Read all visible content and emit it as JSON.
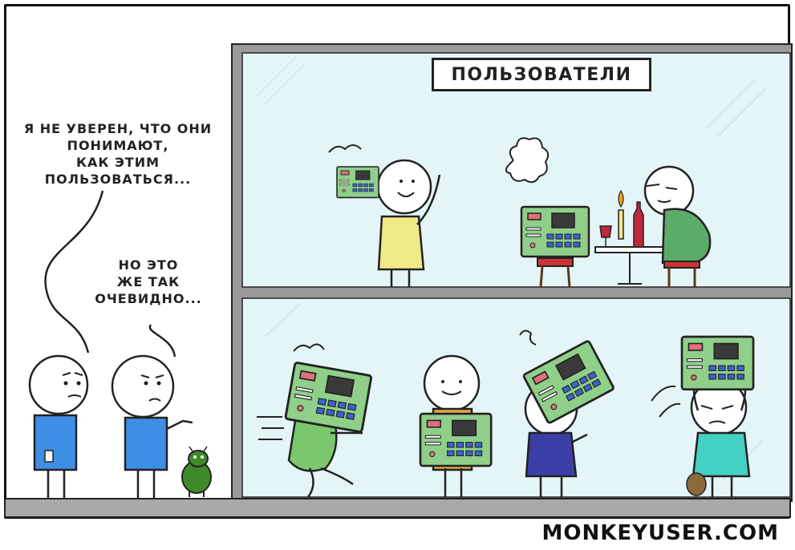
{
  "speech": {
    "left_lines": [
      "Я НЕ УВЕРЕН, ЧТО ОНИ",
      "ПОНИМАЮТ,",
      "КАК ЭТИМ",
      "ПОЛЬЗОВАТЬСЯ..."
    ],
    "right_lines": [
      "НО ЭТО",
      "ЖЕ ТАК",
      "ОЧЕВИДНО..."
    ]
  },
  "room_sign": "ПОЛЬЗОВАТЕЛИ",
  "credit": "MONKEYUSER.COM",
  "colors": {
    "glass": "#e4f5f8",
    "frame": "#9a9a9a",
    "floor": "#a9a9a9",
    "device": "#8fcf8a",
    "device_screen": "#3a3a3a",
    "device_button": "#3c63c9",
    "device_red": "#e0707a",
    "shirt_blue": "#3f8ee6",
    "shirt_yellow": "#f0ea86",
    "shirt_green": "#7bc76e",
    "shirt_orange": "#e6a64a",
    "shirt_navy": "#3b3fa6",
    "shirt_teal": "#45d0c4",
    "shirt_darkgreen": "#5cab69",
    "bug": "#3e8a2a"
  }
}
